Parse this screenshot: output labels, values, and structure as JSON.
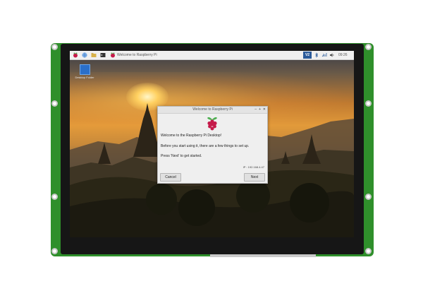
{
  "colors": {
    "pcb": "#2f8f2b",
    "bezel": "#161616",
    "taskbar": "#f0f0f0",
    "dialog_bg": "#efefef",
    "raspberry": "#c51a4a"
  },
  "taskbar": {
    "menu_icon": "raspberry-icon",
    "browser_icon": "globe-icon",
    "files_icon": "folder-icon",
    "terminal_icon": "terminal-icon",
    "active_app_icon": "raspberry-icon",
    "active_app_label": "Welcome to Raspberry Pi",
    "vnc_label": "V2",
    "bluetooth_icon": "bluetooth-icon",
    "network_icon": "network-icon",
    "volume_icon": "volume-icon",
    "clock": "09:26"
  },
  "desktop": {
    "icon_label": "Desktop Folder"
  },
  "dialog": {
    "title": "Welcome to Raspberry Pi",
    "heading": "Welcome to the Raspberry Pi Desktop!",
    "body": "Before you start using it, there are a few things to set up.",
    "instruction": "Press 'Next' to get started.",
    "ip": "IP : 192.168.4.47",
    "cancel_label": "Cancel",
    "next_label": "Next",
    "minimize_glyph": "‒",
    "maximize_glyph": "+",
    "close_glyph": "✕"
  }
}
